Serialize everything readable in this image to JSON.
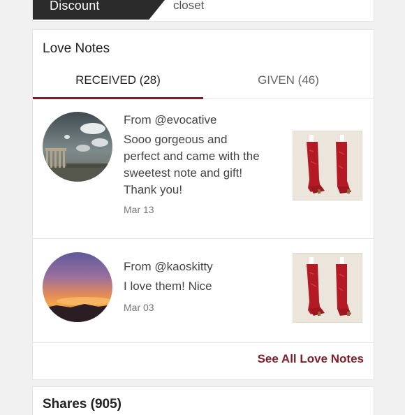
{
  "top": {
    "discount": "Discount",
    "closet": "closet"
  },
  "love_notes": {
    "title": "Love Notes",
    "tabs": [
      {
        "label": "RECEIVED (28)",
        "active": true
      },
      {
        "label": "GIVEN (46)",
        "active": false
      }
    ],
    "notes": [
      {
        "from": "From @evocative",
        "text": "Sooo gorgeous and perfect and came with the sweetest note and gift! Thank you!",
        "date": "Mar 13",
        "avatar_icon": "ruins-landscape-photo",
        "thumb_icon": "red-boots-photo"
      },
      {
        "from": "From @kaoskitty",
        "text": "I love them! Nice",
        "date": "Mar 03",
        "avatar_icon": "sunset-landscape-photo",
        "thumb_icon": "red-boots-photo"
      }
    ],
    "see_all": "See All Love Notes"
  },
  "shares": {
    "title": "Shares (905)"
  },
  "colors": {
    "accent": "#7f1d2a",
    "dark_tab": "#2b2b2b"
  }
}
